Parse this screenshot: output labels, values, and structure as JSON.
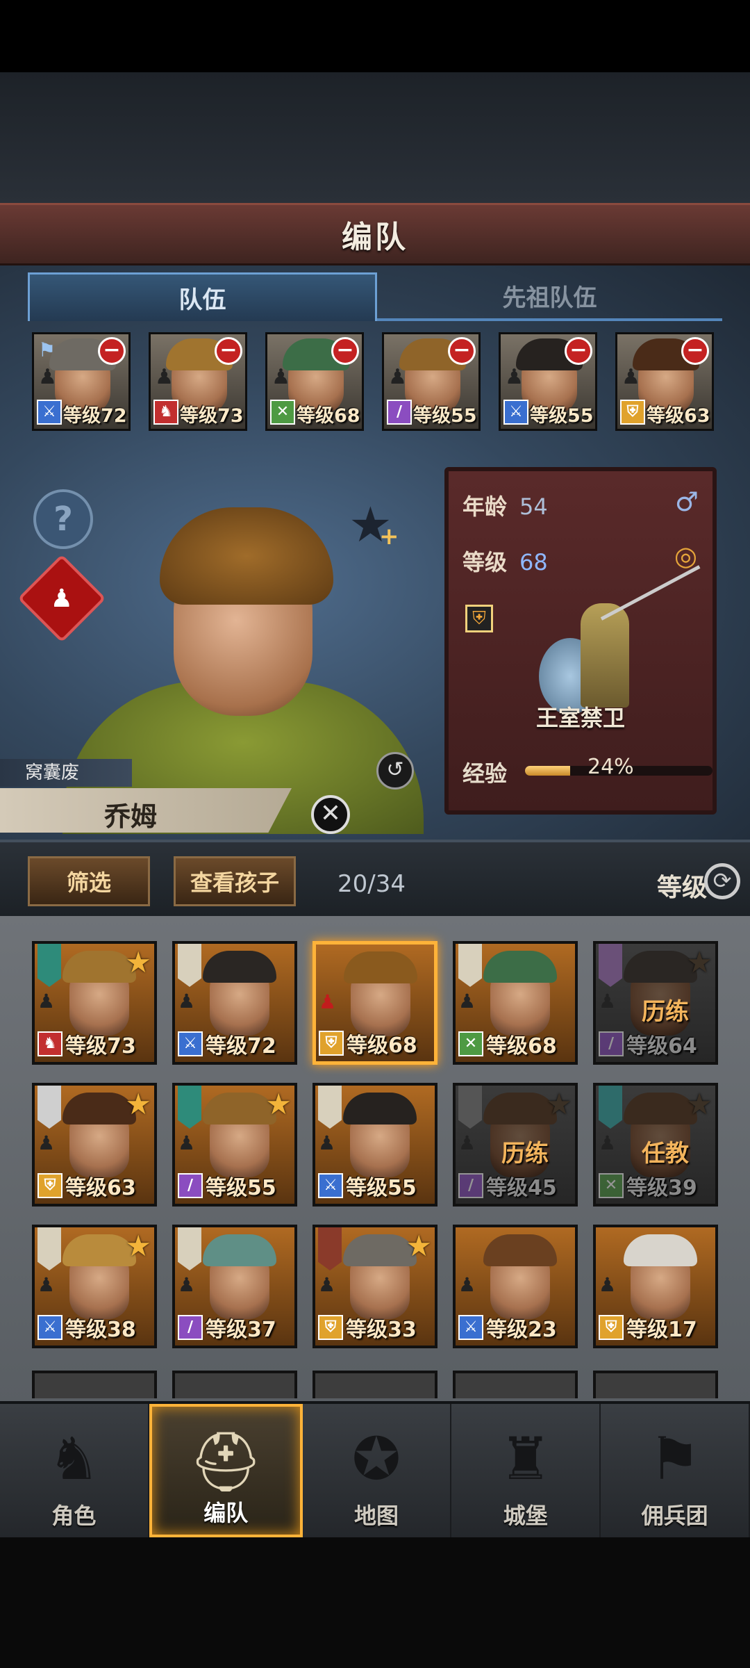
{
  "header": {
    "title": "编队"
  },
  "tabs": [
    {
      "label": "队伍",
      "active": true
    },
    {
      "label": "先祖队伍",
      "active": false
    }
  ],
  "team": [
    {
      "level": "等级72",
      "class_icon": "sword-icon",
      "class_color": "#3a6fd0",
      "hair": "#6e6a63",
      "flag": true
    },
    {
      "level": "等级73",
      "class_icon": "horse-icon",
      "class_color": "#c22f2f",
      "hair": "#a0742f",
      "flag": false
    },
    {
      "level": "等级68",
      "class_icon": "crossed-swords-icon",
      "class_color": "#4e9a43",
      "hair": "#3c6d47",
      "flag": false
    },
    {
      "level": "等级55",
      "class_icon": "staff-icon",
      "class_color": "#8b4dc0",
      "hair": "#8f6429",
      "flag": false
    },
    {
      "level": "等级55",
      "class_icon": "sword-icon",
      "class_color": "#3a6fd0",
      "hair": "#26221f",
      "flag": false
    },
    {
      "level": "等级63",
      "class_icon": "shield-icon",
      "class_color": "#e0a22c",
      "hair": "#4a2b18",
      "flag": false
    }
  ],
  "hero": {
    "title": "窝囊废",
    "name": "乔姆",
    "age_label": "年龄",
    "age": "54",
    "level_label": "等级",
    "level": "68",
    "unit_name": "王室禁卫",
    "exp_label": "经验",
    "exp_percent": "24%",
    "exp_fraction": 0.24
  },
  "filter": {
    "filter_label": "筛选",
    "children_label": "查看孩子",
    "count": "20/34",
    "sort_label": "等级"
  },
  "roster": [
    {
      "level": "等级73",
      "class_color": "#c22f2f",
      "class_icon": "horse-icon",
      "star": true,
      "banner": "#2e8b7a",
      "hair": "#a0742f"
    },
    {
      "level": "等级72",
      "class_color": "#3a6fd0",
      "class_icon": "sword-icon",
      "star": false,
      "banner": "#d8d0bc",
      "hair": "#2a2623"
    },
    {
      "level": "等级68",
      "class_color": "#e0a22c",
      "class_icon": "shield-icon",
      "star": false,
      "banner": "",
      "hair": "#8a5a1e",
      "selected": true
    },
    {
      "level": "等级68",
      "class_color": "#4e9a43",
      "class_icon": "crossed-swords-icon",
      "star": false,
      "banner": "#d8d0bc",
      "hair": "#3c6d47"
    },
    {
      "level": "等级64",
      "class_color": "#8b4dc0",
      "class_icon": "staff-icon",
      "star": true,
      "banner": "#6a5078",
      "hair": "#2a2623",
      "dim": true,
      "job": "历练"
    },
    {
      "level": "等级63",
      "class_color": "#e0a22c",
      "class_icon": "shield-icon",
      "star": true,
      "banner": "#cfcfcf",
      "hair": "#4a2b18"
    },
    {
      "level": "等级55",
      "class_color": "#8b4dc0",
      "class_icon": "staff-icon",
      "star": true,
      "banner": "#2e8b7a",
      "hair": "#8f6429"
    },
    {
      "level": "等级55",
      "class_color": "#3a6fd0",
      "class_icon": "sword-icon",
      "star": false,
      "banner": "#d8d0bc",
      "hair": "#26221f"
    },
    {
      "level": "等级45",
      "class_color": "#8b4dc0",
      "class_icon": "staff-icon",
      "star": true,
      "banner": "#555",
      "hair": "#3a2a1e",
      "dim": true,
      "job": "历练"
    },
    {
      "level": "等级39",
      "class_color": "#4e9a43",
      "class_icon": "crossed-swords-icon",
      "star": true,
      "banner": "#2e6b6a",
      "hair": "#3a2a1e",
      "dim": true,
      "job": "任教"
    },
    {
      "level": "等级38",
      "class_color": "#3a6fd0",
      "class_icon": "sword-icon",
      "star": true,
      "banner": "#d8d0bc",
      "hair": "#b98b3c"
    },
    {
      "level": "等级37",
      "class_color": "#8b4dc0",
      "class_icon": "staff-icon",
      "star": false,
      "banner": "#d8d0bc",
      "hair": "#5f8f86"
    },
    {
      "level": "等级33",
      "class_color": "#e0a22c",
      "class_icon": "shield-icon",
      "star": true,
      "banner": "#8a3a2a",
      "hair": "#6e6a63"
    },
    {
      "level": "等级23",
      "class_color": "#3a6fd0",
      "class_icon": "sword-icon",
      "star": false,
      "banner": "",
      "hair": "#6a4020"
    },
    {
      "level": "等级17",
      "class_color": "#e0a22c",
      "class_icon": "shield-icon",
      "star": false,
      "banner": "",
      "hair": "#d8d4cc"
    }
  ],
  "nav": [
    {
      "label": "角色",
      "icon": "knight-icon",
      "active": false
    },
    {
      "label": "编队",
      "icon": "helmet-icon",
      "active": true
    },
    {
      "label": "地图",
      "icon": "compass-map-icon",
      "active": false
    },
    {
      "label": "城堡",
      "icon": "castle-icon",
      "active": false
    },
    {
      "label": "佣兵团",
      "icon": "mercenary-icon",
      "active": false
    }
  ]
}
